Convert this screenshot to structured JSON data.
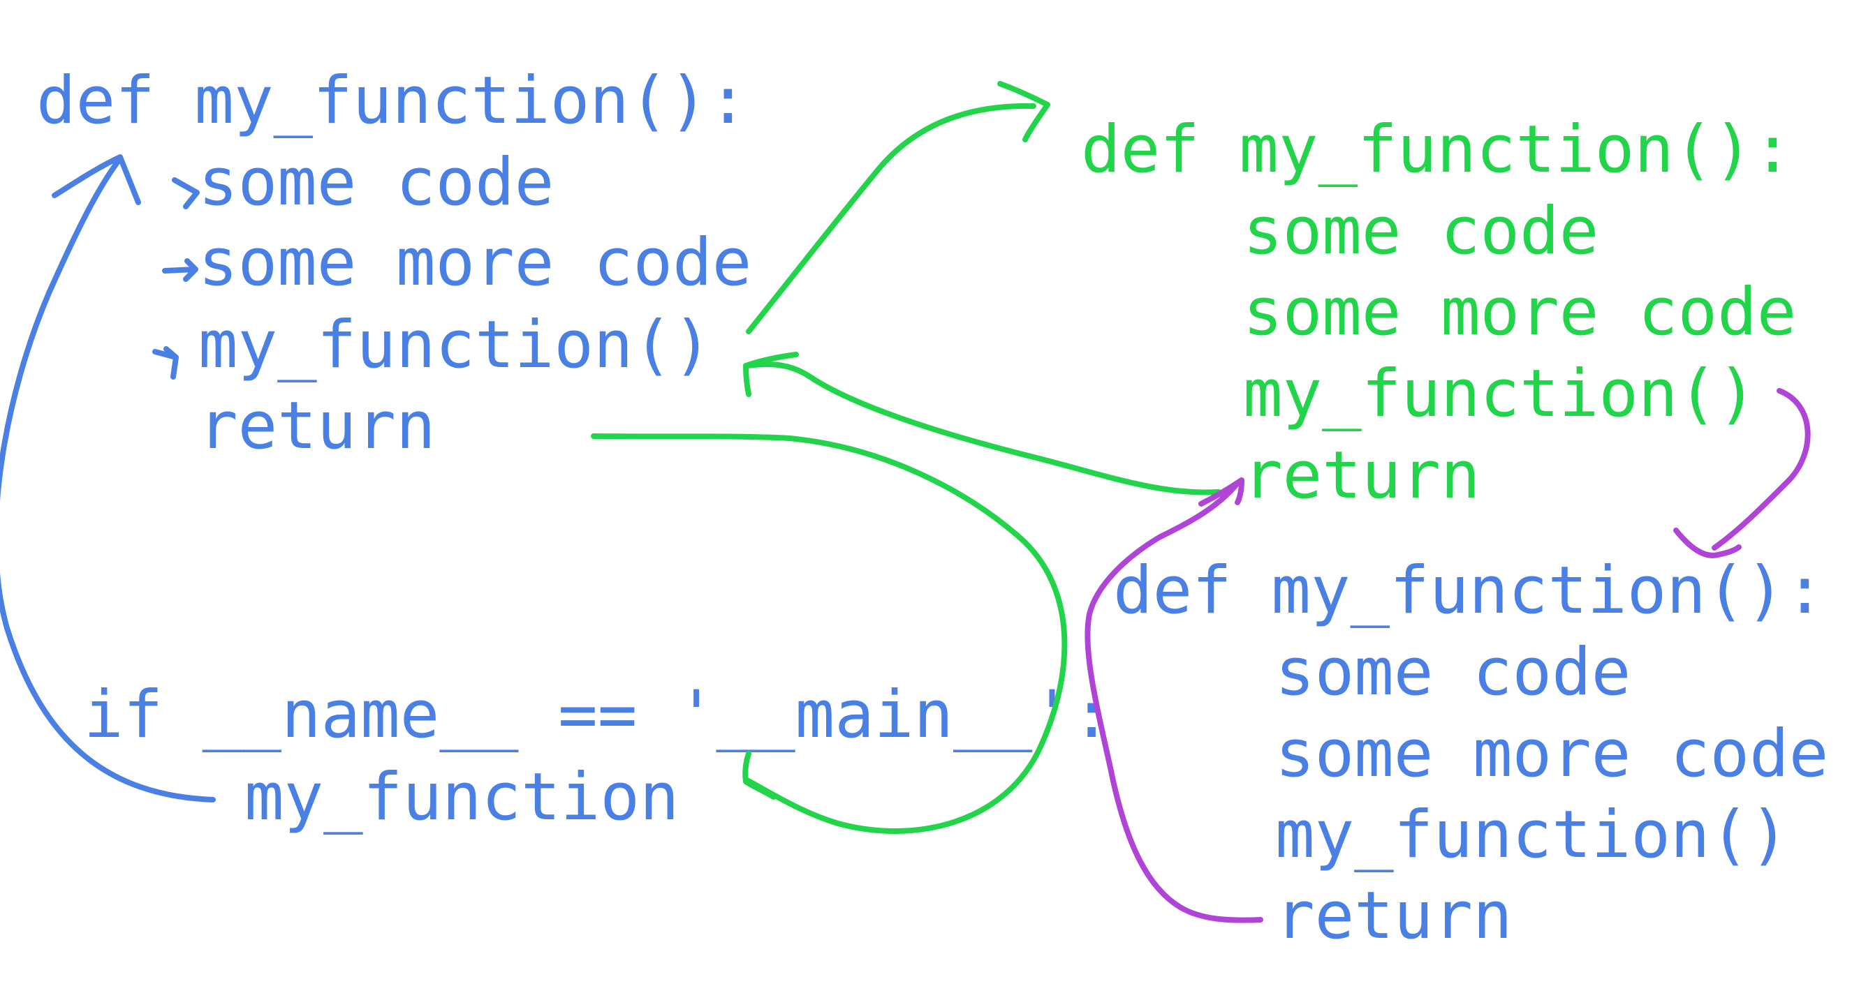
{
  "colors": {
    "blue": "#4a80e3",
    "green": "#22d44a",
    "purple": "#b044d6"
  },
  "block_a": {
    "lines": [
      "def my_function():",
      "some code",
      "some more code",
      "my_function()",
      "return"
    ]
  },
  "block_b": {
    "lines": [
      "if __name__ == '__main__':",
      "my_function"
    ]
  },
  "block_c": {
    "lines": [
      "def my_function():",
      "some code",
      "some more code",
      "my_function()",
      "return"
    ]
  },
  "block_d": {
    "lines": [
      "def my_function():",
      "some code",
      "some more code",
      "my_function()",
      "return"
    ]
  }
}
